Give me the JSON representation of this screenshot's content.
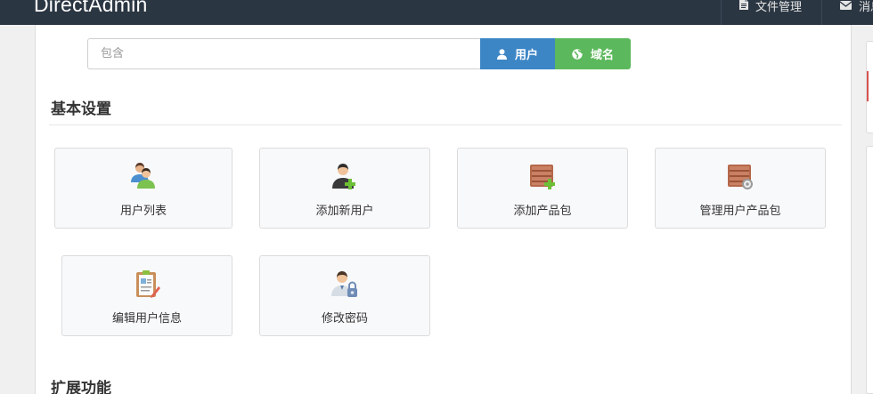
{
  "topbar": {
    "brand": "DirectAdmin",
    "file_manager_label": "文件管理",
    "messages_label": "消息"
  },
  "search": {
    "placeholder": "包含",
    "value": "",
    "user_button_label": "用户",
    "domain_button_label": "域名"
  },
  "sections": {
    "basic_settings": "基本设置",
    "extensions": "扩展功能"
  },
  "cards": [
    {
      "label": "用户列表",
      "icon": "users-icon"
    },
    {
      "label": "添加新用户",
      "icon": "add-user-icon"
    },
    {
      "label": "添加产品包",
      "icon": "add-package-icon"
    },
    {
      "label": "管理用户产品包",
      "icon": "manage-packages-icon"
    },
    {
      "label": "编辑用户信息",
      "icon": "edit-user-info-icon"
    },
    {
      "label": "修改密码",
      "icon": "change-password-icon"
    }
  ],
  "colors": {
    "topbar": "#2b3643",
    "user_button": "#3d86c6",
    "domain_button": "#5cb85c",
    "alert": "#d9534f"
  }
}
